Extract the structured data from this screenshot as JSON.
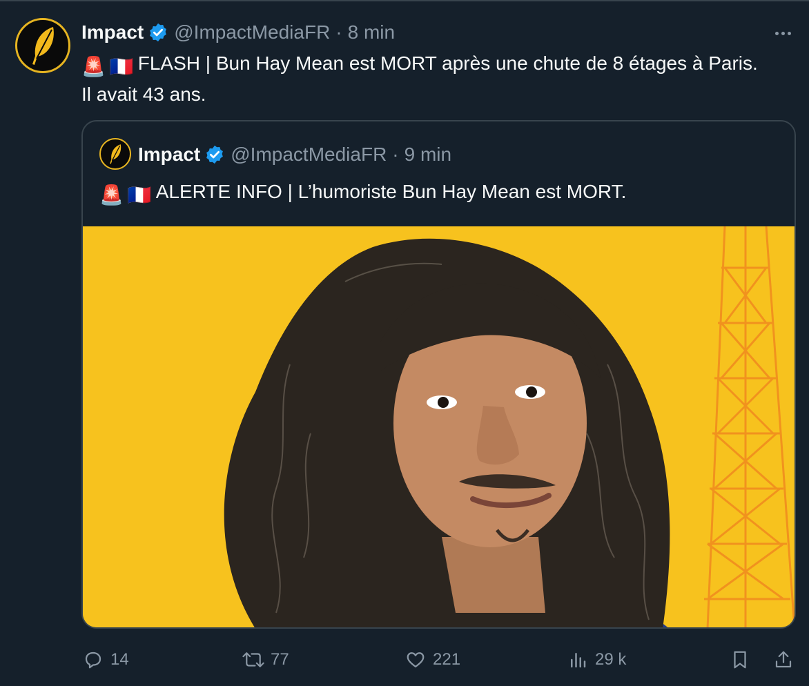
{
  "tweet": {
    "author": {
      "name": "Impact",
      "handle": "@ImpactMediaFR",
      "time": "8 min"
    },
    "emoji": [
      "🚨",
      "🇫🇷"
    ],
    "text": "FLASH | Bun Hay Mean est MORT après une chute de 8 étages à Paris. Il avait 43 ans."
  },
  "quoted": {
    "author": {
      "name": "Impact",
      "handle": "@ImpactMediaFR",
      "time": "9 min"
    },
    "emoji": [
      "🚨",
      "🇫🇷"
    ],
    "text": "ALERTE INFO | L’humoriste Bun Hay Mean est MORT."
  },
  "actions": {
    "replies": "14",
    "retweets": "77",
    "likes": "221",
    "views": "29 k"
  },
  "colors": {
    "background": "#15202b",
    "text": "#f7f9f9",
    "muted": "#8b98a5",
    "border": "#38444d",
    "verified": "#1d9bf0",
    "photo_background": "#f7c21e"
  },
  "icons": [
    "feather-logo-icon",
    "verified-badge-icon",
    "more-icon",
    "reply-icon",
    "retweet-icon",
    "like-icon",
    "views-icon",
    "bookmark-icon",
    "share-icon",
    "siren-emoji-icon",
    "france-flag-emoji-icon"
  ]
}
